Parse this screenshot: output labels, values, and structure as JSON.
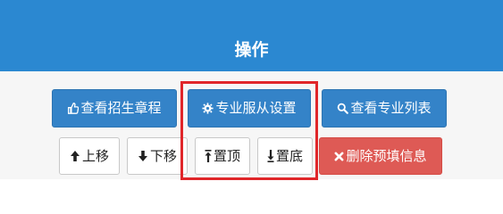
{
  "header": {
    "title": "操作"
  },
  "actions_row1": {
    "view_admission_rules": {
      "label": "查看招生章程",
      "icon": "thumbs-up-icon"
    },
    "major_adjustment_settings": {
      "label": "专业服从设置",
      "icon": "gear-icon"
    },
    "view_major_list": {
      "label": "查看专业列表",
      "icon": "search-icon"
    }
  },
  "actions_row2": {
    "move_up": {
      "label": "上移",
      "icon": "arrow-up-icon"
    },
    "move_down": {
      "label": "下移",
      "icon": "arrow-down-icon"
    },
    "move_top": {
      "label": "置顶",
      "icon": "arrow-to-top-icon"
    },
    "move_bottom": {
      "label": "置底",
      "icon": "arrow-to-bottom-icon"
    },
    "delete_prefill": {
      "label": "删除预填信息",
      "icon": "close-icon"
    }
  },
  "colors": {
    "header_bg": "#2b88d1",
    "primary": "#3483c8",
    "danger": "#de5a55",
    "highlight": "#e0262a"
  }
}
